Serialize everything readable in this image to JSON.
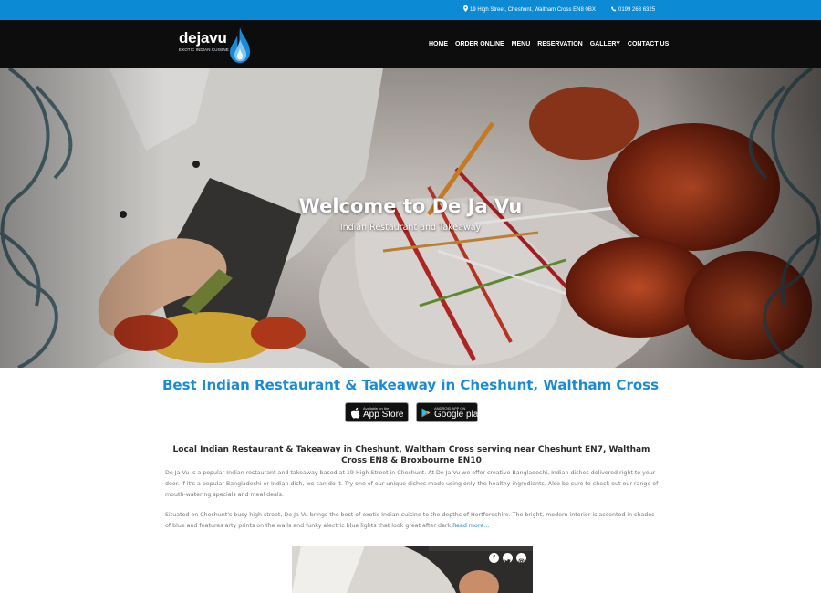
{
  "topbar": {
    "address": "19 High Street, Cheshunt, Waltham Cross EN8 0BX",
    "phone": "0199 263 6325",
    "address_icon": "map-marker-icon",
    "phone_icon": "phone-icon"
  },
  "brand": {
    "name": "dejavu",
    "tagline": "EXOTIC INDIAN CUISINE",
    "accent": "#1a8bd6"
  },
  "nav": {
    "items": [
      "HOME",
      "ORDER ONLINE",
      "MENU",
      "RESERVATION",
      "GALLERY",
      "CONTACT US"
    ]
  },
  "hero": {
    "title": "Welcome to De Ja Vu",
    "subtitle": "Indian Restaurant and Takeaway"
  },
  "main": {
    "title": "Best Indian Restaurant & Takeaway in Cheshunt, Waltham Cross",
    "app_store_small": "Available on the",
    "app_store_big": "App Store",
    "google_play_small": "ANDROID APP ON",
    "google_play_big": "Google play",
    "subheading": "Local Indian Restaurant & Takeaway in Cheshunt, Waltham Cross serving near Cheshunt EN7, Waltham Cross EN8 & Broxbourne EN10",
    "paragraph1": "De Ja Vu is a popular Indian restaurant and takeaway based at 19 High Street in Cheshunt. At De Ja Vu we offer creative Bangladeshi, Indian dishes delivered right to your door. If it's a popular Bangladeshi or Indian dish, we can do it. Try one of our unique dishes made using only the healthy ingredients. Also be sure to check out our range of mouth-watering specials and meal deals.",
    "paragraph2": "Situated on Cheshunt's busy high street, De Ja Vu brings the best of exotic Indian cuisine to the depths of Hertfordshire. The bright, modern interior is accented in shades of blue and features arty prints on the walls and funky electric blue lights that look great after dark.",
    "read_more": "Read more..."
  },
  "social": {
    "icons": [
      "facebook-icon",
      "twitter-icon",
      "instagram-icon"
    ]
  }
}
